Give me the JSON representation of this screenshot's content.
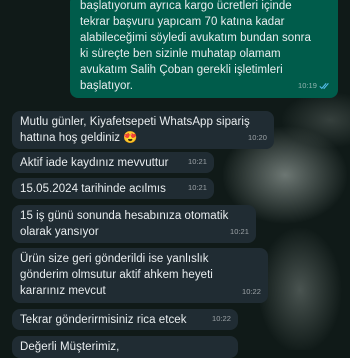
{
  "theme": {
    "chat_background": "#101a18",
    "outgoing_bubble": "#005c4b",
    "incoming_bubble": "#202c33",
    "text_color": "#e9edef",
    "read_tick_color": "#53bdeb"
  },
  "messages": [
    {
      "direction": "outgoing",
      "text": "başlatıyorum ayrıca kargo ücretleri içinde\ntekrar başvuru yapıcam 70 katına kadar\nalabileceğimi söyledi avukatım bundan sonra\nki süreçte ben sizinle muhatap olamam\navukatım Salih Çoban gerekli işletimleri\nbaşlatıyor.",
      "time": "10:19",
      "status_icon": "double-check-icon"
    },
    {
      "direction": "incoming",
      "text": "Mutlu günler, Kiyafetsepeti WhatsApp sipariş\nhattına hoş geldiniz 😍",
      "time": "10:20"
    },
    {
      "direction": "incoming",
      "text": "Aktif iade kaydınız mevvuttur",
      "time": "10:21"
    },
    {
      "direction": "incoming",
      "text": "15.05.2024 tarihinde acılmıs",
      "time": "10:21"
    },
    {
      "direction": "incoming",
      "text": "15 iş günü sonunda hesabınıza otomatik\nolarak yansıyor",
      "time": "10:21"
    },
    {
      "direction": "incoming",
      "text": "Ürün size geri gönderildi ise yanlıslık\ngönderim olmsutur aktif ahkem heyeti\nkararınız mevcut",
      "time": "10:22"
    },
    {
      "direction": "incoming",
      "text": "Tekrar gönderirmisiniz rica etcek",
      "time": "10:22"
    },
    {
      "direction": "incoming",
      "text": "Değerli Müşterimiz,",
      "time": ""
    }
  ]
}
